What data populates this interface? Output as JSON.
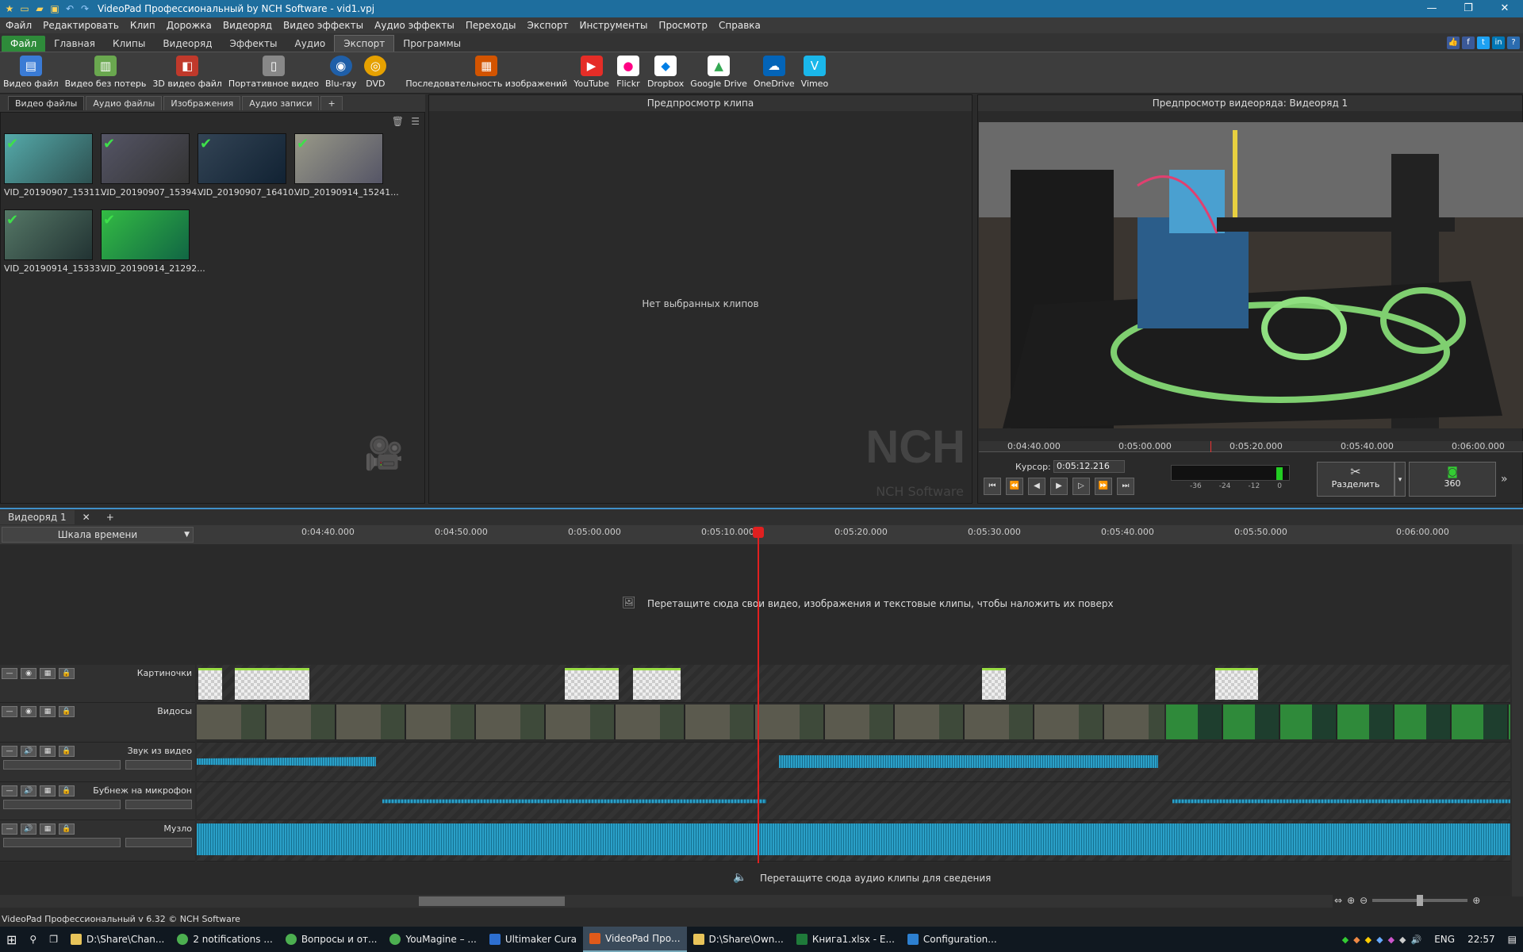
{
  "window": {
    "title": "VideoPad Профессиональный by NCH Software - vid1.vpj"
  },
  "menu": [
    "Файл",
    "Редактировать",
    "Клип",
    "Дорожка",
    "Видеоряд",
    "Видео эффекты",
    "Аудио эффекты",
    "Переходы",
    "Экспорт",
    "Инструменты",
    "Просмотр",
    "Справка"
  ],
  "ribbon_tabs": [
    "Файл",
    "Главная",
    "Клипы",
    "Видеоряд",
    "Эффекты",
    "Аудио",
    "Экспорт",
    "Программы"
  ],
  "toolbar": [
    {
      "label": "Видео файл",
      "icon": "film-export-icon",
      "color": "#3a7bd5"
    },
    {
      "label": "Видео без потерь",
      "icon": "lossless-icon",
      "color": "#6aa84f"
    },
    {
      "label": "3D видео файл",
      "icon": "3d-icon",
      "color": "#c0392b"
    },
    {
      "label": "Портативное видео",
      "icon": "portable-icon",
      "color": "#888"
    },
    {
      "label": "Blu-ray",
      "icon": "bluray-icon",
      "color": "#1f5fa8"
    },
    {
      "label": "DVD",
      "icon": "dvd-icon",
      "color": "#e6a100"
    },
    {
      "label": "Последовательность изображений",
      "icon": "image-seq-icon",
      "color": "#d35400"
    },
    {
      "label": "YouTube",
      "icon": "youtube-icon",
      "color": "#e52d27"
    },
    {
      "label": "Flickr",
      "icon": "flickr-icon",
      "color": "#ff0084"
    },
    {
      "label": "Dropbox",
      "icon": "dropbox-icon",
      "color": "#007ee5"
    },
    {
      "label": "Google Drive",
      "icon": "drive-icon",
      "color": "#34a853"
    },
    {
      "label": "OneDrive",
      "icon": "onedrive-icon",
      "color": "#0364b8"
    },
    {
      "label": "Vimeo",
      "icon": "vimeo-icon",
      "color": "#1ab7ea"
    }
  ],
  "bins": {
    "tabs": [
      "Видео файлы",
      "Аудио файлы",
      "Изображения",
      "Аудио записи",
      "+"
    ],
    "files": [
      {
        "name": "VID_20190907_15311...",
        "color": "#3d6b6a"
      },
      {
        "name": "VID_20190907_15394...",
        "color": "#4a4a5a"
      },
      {
        "name": "VID_20190907_16410...",
        "color": "#2b3a55"
      },
      {
        "name": "VID_20190914_15241...",
        "color": "#6b6b5e"
      },
      {
        "name": "VID_20190914_15333...",
        "color": "#3e5a3a"
      },
      {
        "name": "VID_20190914_21292...",
        "color": "#2f7a3a"
      }
    ]
  },
  "clip_preview": {
    "title": "Предпросмотр клипа",
    "empty_text": "Нет выбранных клипов",
    "watermark": "NCH",
    "watermark_sub": "NCH Software"
  },
  "seq_preview": {
    "title": "Предпросмотр видеоряда: Видеоряд 1",
    "ticks": [
      "0:04:40.000",
      "0:05:00.000",
      "0:05:20.000",
      "0:05:40.000",
      "0:06:00.000"
    ],
    "cursor_label": "Курсор:",
    "cursor_value": "0:05:12.216",
    "meter_labels": [
      "-36",
      "-24",
      "-12",
      "0"
    ],
    "split_label": "Разделить",
    "vr_label": "360"
  },
  "timeline": {
    "tab": "Видеоряд 1",
    "scale_label": "Шкала времени",
    "ticks": [
      "0:04:40.000",
      "0:04:50.000",
      "0:05:00.000",
      "0:05:10.000",
      "0:05:20.000",
      "0:05:30.000",
      "0:05:40.000",
      "0:05:50.000",
      "0:06:00.000"
    ],
    "overlay_hint": "Перетащите сюда свои видео, изображения и текстовые клипы, чтобы наложить их поверх",
    "audio_hint": "Перетащите сюда аудио клипы для сведения",
    "tracks": [
      "Картиночки",
      "Видосы",
      "Звук из видео",
      "Бубнеж на микрофон",
      "Музло"
    ]
  },
  "status": {
    "text": "VideoPad Профессиональный v 6.32 © NCH Software"
  },
  "taskbar": {
    "items": [
      {
        "label": "D:\\Share\\Chan...",
        "color": "#e8c45a"
      },
      {
        "label": "2 notifications ...",
        "color": "#4caf50"
      },
      {
        "label": "Вопросы и от...",
        "color": "#4caf50"
      },
      {
        "label": "YouMagine – ...",
        "color": "#4caf50"
      },
      {
        "label": "Ultimaker Cura",
        "color": "#2d6fd0"
      },
      {
        "label": "VideoPad Про...",
        "color": "#e05a1a"
      },
      {
        "label": "D:\\Share\\Own...",
        "color": "#e8c45a"
      },
      {
        "label": "Книга1.xlsx - E...",
        "color": "#1f7a3a"
      },
      {
        "label": "Configuration...",
        "color": "#2d80d0"
      }
    ],
    "lang": "ENG",
    "clock": "22:57"
  }
}
